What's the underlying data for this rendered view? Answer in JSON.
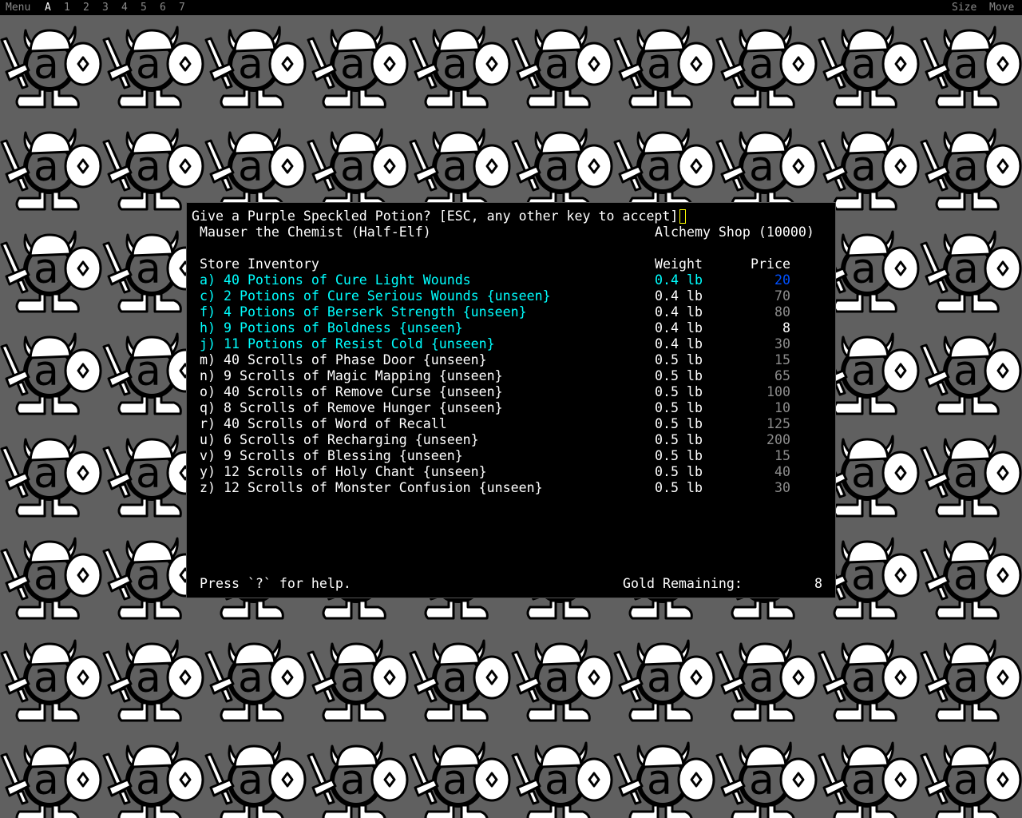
{
  "topbar": {
    "menu": "Menu",
    "tabs": [
      "A",
      "1",
      "2",
      "3",
      "4",
      "5",
      "6",
      "7"
    ],
    "size": "Size",
    "move": "Move"
  },
  "prompt": "Give a Purple Speckled Potion? [ESC, any other key to accept]",
  "shopkeeper": "Mauser the Chemist (Half-Elf)",
  "shop_name": "Alchemy Shop (10000)",
  "headers": {
    "inventory": "Store Inventory",
    "weight": "Weight",
    "price": "Price"
  },
  "items": [
    {
      "label": "a) 40 Potions of Cure Light Wounds",
      "weight": "0.4 lb",
      "price": "20",
      "color": "cyan",
      "selected": true
    },
    {
      "label": "c) 2 Potions of Cure Serious Wounds {unseen}",
      "weight": "0.4 lb",
      "price": "70",
      "color": "cyan"
    },
    {
      "label": "f) 4 Potions of Berserk Strength {unseen}",
      "weight": "0.4 lb",
      "price": "80",
      "color": "cyan"
    },
    {
      "label": "h) 9 Potions of Boldness {unseen}",
      "weight": "0.4 lb",
      "price": "8",
      "color": "cyan",
      "affordable": true
    },
    {
      "label": "j) 11 Potions of Resist Cold {unseen}",
      "weight": "0.4 lb",
      "price": "30",
      "color": "cyan"
    },
    {
      "label": "m) 40 Scrolls of Phase Door {unseen}",
      "weight": "0.5 lb",
      "price": "15",
      "color": "white"
    },
    {
      "label": "n) 9 Scrolls of Magic Mapping {unseen}",
      "weight": "0.5 lb",
      "price": "65",
      "color": "white"
    },
    {
      "label": "o) 40 Scrolls of Remove Curse {unseen}",
      "weight": "0.5 lb",
      "price": "100",
      "color": "white"
    },
    {
      "label": "q) 8 Scrolls of Remove Hunger {unseen}",
      "weight": "0.5 lb",
      "price": "10",
      "color": "white"
    },
    {
      "label": "r) 40 Scrolls of Word of Recall",
      "weight": "0.5 lb",
      "price": "125",
      "color": "white"
    },
    {
      "label": "u) 6 Scrolls of Recharging {unseen}",
      "weight": "0.5 lb",
      "price": "200",
      "color": "white"
    },
    {
      "label": "v) 9 Scrolls of Blessing {unseen}",
      "weight": "0.5 lb",
      "price": "15",
      "color": "white"
    },
    {
      "label": "y) 12 Scrolls of Holy Chant {unseen}",
      "weight": "0.5 lb",
      "price": "40",
      "color": "white"
    },
    {
      "label": "z) 12 Scrolls of Monster Confusion {unseen}",
      "weight": "0.5 lb",
      "price": "30",
      "color": "white"
    }
  ],
  "help": "Press `?` for help.",
  "gold_label": "Gold Remaining:",
  "gold_value": "8",
  "colors": {
    "cyan": "#00ffff",
    "selected_price": "#0050ff",
    "price": "#8c8c8c",
    "cursor": "#ffff00"
  }
}
